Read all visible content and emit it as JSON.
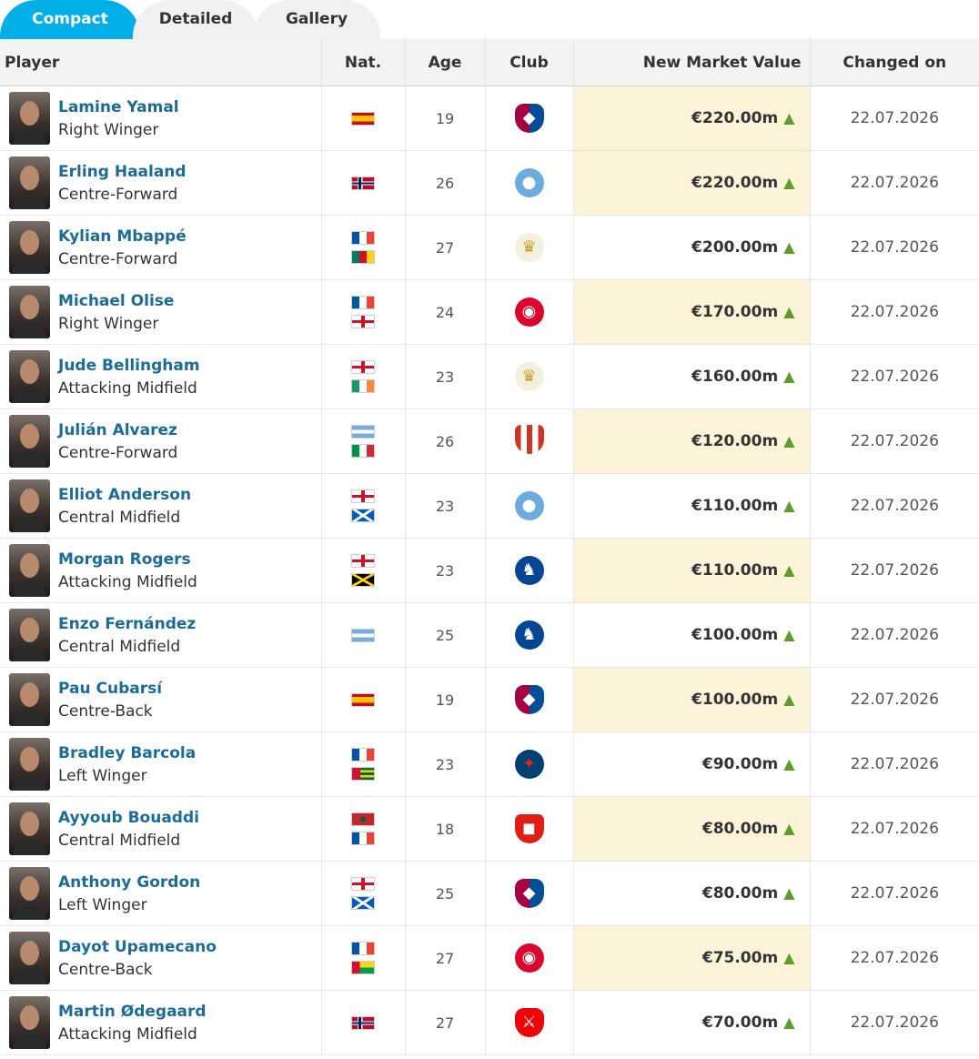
{
  "tabs": [
    "Compact",
    "Detailed",
    "Gallery"
  ],
  "headers": {
    "player": "Player",
    "nat": "Nat.",
    "age": "Age",
    "club": "Club",
    "value": "New Market Value",
    "changed": "Changed on"
  },
  "rows": [
    {
      "name": "Lamine Yamal",
      "position": "Right Winger",
      "age": "19",
      "value": "€220.00m",
      "date": "22.07.2026",
      "flags": [
        "flag-spain"
      ],
      "club": "FC Barcelona-crest",
      "highlight": true
    },
    {
      "name": "Erling Haaland",
      "position": "Centre-Forward",
      "age": "26",
      "value": "€220.00m",
      "date": "22.07.2026",
      "flags": [
        "flag-norway"
      ],
      "club": "Manchester City-crest",
      "highlight": true
    },
    {
      "name": "Kylian Mbappé",
      "position": "Centre-Forward",
      "age": "27",
      "value": "€200.00m",
      "date": "22.07.2026",
      "flags": [
        "flag-france",
        "flag-cameroon"
      ],
      "club": "Real Madrid-crest",
      "highlight": false
    },
    {
      "name": "Michael Olise",
      "position": "Right Winger",
      "age": "24",
      "value": "€170.00m",
      "date": "22.07.2026",
      "flags": [
        "flag-france",
        "flag-england"
      ],
      "club": "Bayern Munich-crest",
      "highlight": true
    },
    {
      "name": "Jude Bellingham",
      "position": "Attacking Midfield",
      "age": "23",
      "value": "€160.00m",
      "date": "22.07.2026",
      "flags": [
        "flag-england",
        "flag-ireland"
      ],
      "club": "Real Madrid-crest",
      "highlight": false
    },
    {
      "name": "Julián Alvarez",
      "position": "Centre-Forward",
      "age": "26",
      "value": "€120.00m",
      "date": "22.07.2026",
      "flags": [
        "flag-argentina",
        "flag-italy"
      ],
      "club": "Atletico Madrid-crest",
      "highlight": true
    },
    {
      "name": "Elliot Anderson",
      "position": "Central Midfield",
      "age": "23",
      "value": "€110.00m",
      "date": "22.07.2026",
      "flags": [
        "flag-england",
        "flag-scotland"
      ],
      "club": "Manchester City-crest",
      "highlight": false
    },
    {
      "name": "Morgan Rogers",
      "position": "Attacking Midfield",
      "age": "23",
      "value": "€110.00m",
      "date": "22.07.2026",
      "flags": [
        "flag-england",
        "flag-jamaica"
      ],
      "club": "Chelsea-crest",
      "highlight": true
    },
    {
      "name": "Enzo Fernández",
      "position": "Central Midfield",
      "age": "25",
      "value": "€100.00m",
      "date": "22.07.2026",
      "flags": [
        "flag-argentina"
      ],
      "club": "Chelsea-crest",
      "highlight": false
    },
    {
      "name": "Pau Cubarsí",
      "position": "Centre-Back",
      "age": "19",
      "value": "€100.00m",
      "date": "22.07.2026",
      "flags": [
        "flag-spain"
      ],
      "club": "FC Barcelona-crest",
      "highlight": true
    },
    {
      "name": "Bradley Barcola",
      "position": "Left Winger",
      "age": "23",
      "value": "€90.00m",
      "date": "22.07.2026",
      "flags": [
        "flag-france",
        "flag-togo"
      ],
      "club": "Paris Saint-Germain-crest",
      "highlight": false
    },
    {
      "name": "Ayyoub Bouaddi",
      "position": "Central Midfield",
      "age": "18",
      "value": "€80.00m",
      "date": "22.07.2026",
      "flags": [
        "flag-morocco",
        "flag-france"
      ],
      "club": "LOSC Lille-crest",
      "highlight": true
    },
    {
      "name": "Anthony Gordon",
      "position": "Left Winger",
      "age": "25",
      "value": "€80.00m",
      "date": "22.07.2026",
      "flags": [
        "flag-england",
        "flag-scotland"
      ],
      "club": "FC Barcelona-crest",
      "highlight": false
    },
    {
      "name": "Dayot Upamecano",
      "position": "Centre-Back",
      "age": "27",
      "value": "€75.00m",
      "date": "22.07.2026",
      "flags": [
        "flag-france",
        "flag-guinea-bissau"
      ],
      "club": "Bayern Munich-crest",
      "highlight": true
    },
    {
      "name": "Martin Ødegaard",
      "position": "Attacking Midfield",
      "age": "27",
      "value": "€70.00m",
      "date": "22.07.2026",
      "flags": [
        "flag-norway"
      ],
      "club": "Arsenal-crest",
      "highlight": false
    }
  ],
  "colors": {
    "tab_active": "#00aee8",
    "tab_inactive": "#f1f1f1",
    "name_link": "#1c6c99",
    "value_highlight": "#fdf3d8",
    "arrow_up": "#5b9f2a"
  }
}
